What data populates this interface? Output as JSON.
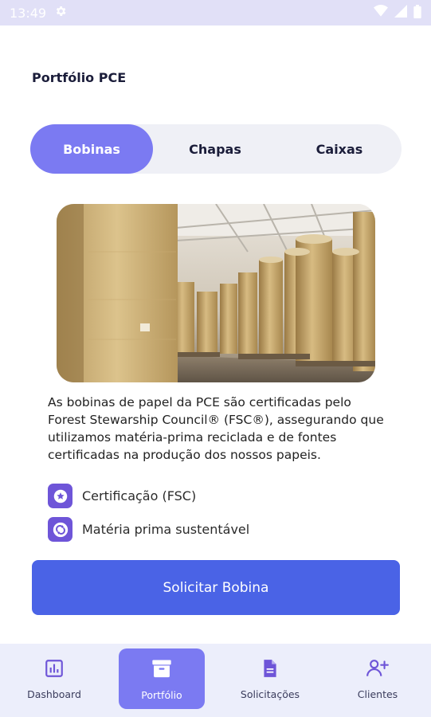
{
  "status_bar": {
    "time": "13:49"
  },
  "header": {
    "title": "Portfólio PCE"
  },
  "tabs": [
    {
      "label": "Bobinas",
      "active": true
    },
    {
      "label": "Chapas",
      "active": false
    },
    {
      "label": "Caixas",
      "active": false
    }
  ],
  "product": {
    "description": "As bobinas de papel da PCE são certificadas pelo Forest Stewarship Council® (FSC®), assegurando que utilizamos matéria-prima reciclada e de fontes certificadas na produção dos nossos papeis.",
    "features": [
      {
        "icon": "star-icon",
        "label": "Certificação (FSC)"
      },
      {
        "icon": "recycle-icon",
        "label": "Matéria prima sustentável"
      }
    ],
    "cta_label": "Solicitar Bobina"
  },
  "bottom_nav": [
    {
      "icon": "dashboard-icon",
      "label": "Dashboard",
      "active": false
    },
    {
      "icon": "archive-box-icon",
      "label": "Portfólio",
      "active": true
    },
    {
      "icon": "document-icon",
      "label": "Solicitações",
      "active": false
    },
    {
      "icon": "add-user-icon",
      "label": "Clientes",
      "active": false
    }
  ],
  "colors": {
    "accent": "#7b7af2",
    "primary_button": "#4a63e6",
    "icon_bg": "#6e55d8",
    "status_bar": "#e1e0f7"
  }
}
